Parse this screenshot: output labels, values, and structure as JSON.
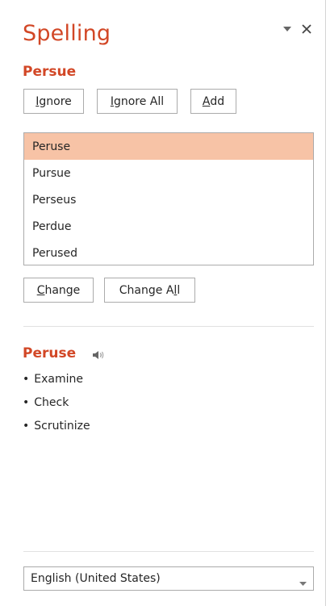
{
  "pane": {
    "title": "Spelling",
    "options_icon": "chevron-down-icon",
    "close_icon": "close-icon"
  },
  "misspelled_word": "Persue",
  "actions": {
    "ignore": {
      "first": "I",
      "rest": "gnore"
    },
    "ignore_all": {
      "first": "I",
      "rest": "gnore All"
    },
    "add": {
      "first": "A",
      "rest": "dd"
    }
  },
  "suggestions": [
    "Peruse",
    "Pursue",
    "Perseus",
    "Perdue",
    "Perused"
  ],
  "selected_suggestion": "Peruse",
  "change_actions": {
    "change": {
      "first": "C",
      "rest": "hange"
    },
    "change_all": {
      "before": "Change A",
      "ul": "l",
      "after": "l"
    }
  },
  "definition": {
    "word": "Peruse",
    "speaker_icon": "speaker-icon",
    "synonyms": [
      "Examine",
      "Check",
      "Scrutinize"
    ]
  },
  "language": {
    "selected": "English (United States)"
  },
  "colors": {
    "accent": "#d24726",
    "selection": "#f7c3a6"
  }
}
